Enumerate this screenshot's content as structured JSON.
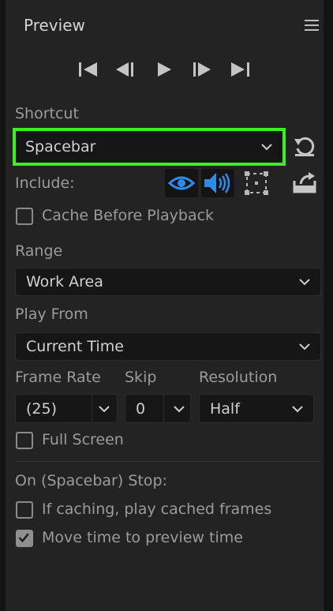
{
  "panel": {
    "title": "Preview",
    "menu_icon": "hamburger-menu-icon"
  },
  "transport": {
    "buttons": [
      "go-to-first-frame-icon",
      "previous-frame-icon",
      "play-icon",
      "next-frame-icon",
      "go-to-last-frame-icon"
    ]
  },
  "shortcut": {
    "label": "Shortcut",
    "value": "Spacebar",
    "highlight_color": "#3af01e",
    "reset_icon": "reset-icon"
  },
  "include": {
    "label": "Include:",
    "video_icon": "eye-icon",
    "audio_icon": "speaker-icon",
    "overlays_icon": "overlay-bounds-icon",
    "export_icon": "export-icon",
    "active_color": "#2d8ceb"
  },
  "cache": {
    "label": "Cache Before Playback",
    "checked": false
  },
  "range": {
    "label": "Range",
    "value": "Work Area"
  },
  "play_from": {
    "label": "Play From",
    "value": "Current Time"
  },
  "frame_rate": {
    "label": "Frame Rate",
    "value": "(25)"
  },
  "skip": {
    "label": "Skip",
    "value": "0"
  },
  "resolution": {
    "label": "Resolution",
    "value": "Half"
  },
  "full_screen": {
    "label": "Full Screen",
    "checked": false
  },
  "stop": {
    "label": "On (Spacebar) Stop:",
    "option1": {
      "label": "If caching, play cached frames",
      "checked": false
    },
    "option2": {
      "label": "Move time to preview time",
      "checked": true
    }
  }
}
